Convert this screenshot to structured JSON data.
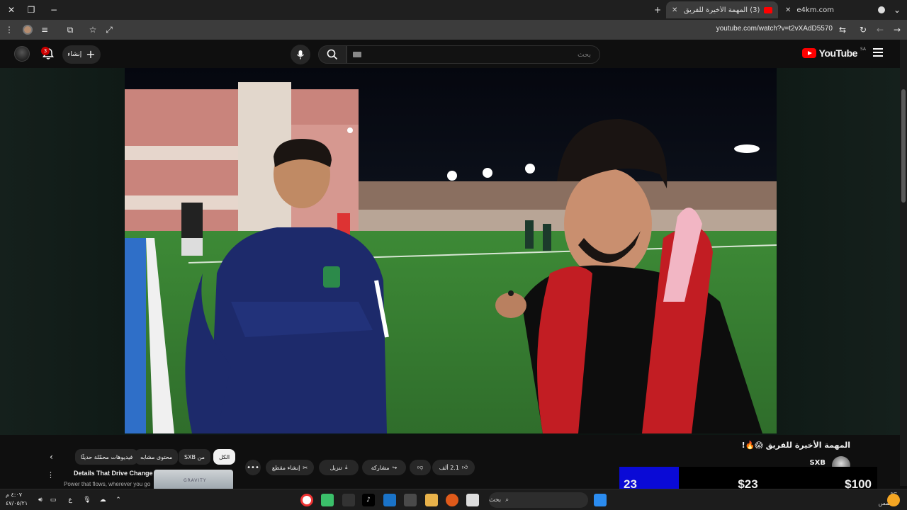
{
  "browser": {
    "tabs": [
      {
        "title": "(3) المهمة الأخيرة للفريق 😱"
      },
      {
        "title": "e4km.com"
      }
    ],
    "new_tab": "+",
    "url": "youtube.com/watch?v=t2vXAdD5570"
  },
  "masthead": {
    "logo_text": "YouTube",
    "region": "SA",
    "search_placeholder": "بحث",
    "create_label": "إنشاء",
    "notifications_count": "3"
  },
  "video": {
    "title": "المهمة الأخيرة للفريق 😱🔥!",
    "channel": "SXB",
    "actions": {
      "likes": "2.1 ألف",
      "share": "مشاركة",
      "download": "تنزيل",
      "clip": "إنشاء مقطع"
    }
  },
  "chips": [
    "الكل",
    "من SXB",
    "محتوى مشابه",
    "فيديوهات محمّلة حديثًا"
  ],
  "recommendation": {
    "title": "Details That Drive Change",
    "subtitle": "Power that flows, wherever you go",
    "thumb_text": "GRAVITY"
  },
  "overlay": {
    "count": "23",
    "middle": "$23",
    "right": "$100"
  },
  "taskbar": {
    "search_label": "بحث",
    "time": "٤:٠٧ م",
    "date": "٤٧/٠٥/٢١",
    "lang": "ع",
    "weather_temp": "°C",
    "weather_label": "مشمس"
  },
  "colors": {
    "accent": "#ff0000",
    "overlay_blue": "#0a0ad6"
  }
}
